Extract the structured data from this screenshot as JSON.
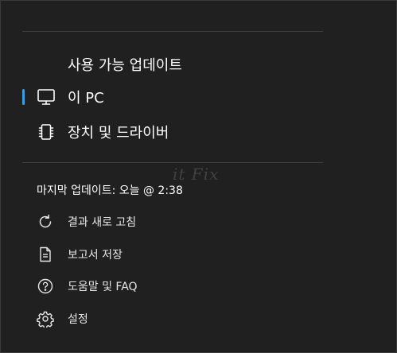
{
  "nav": {
    "items": [
      {
        "label": "사용 가능 업데이트",
        "icon": "",
        "selected": false
      },
      {
        "label": "이 PC",
        "icon": "monitor-icon",
        "selected": true
      },
      {
        "label": "장치 및 드라이버",
        "icon": "chip-icon",
        "selected": false
      }
    ]
  },
  "status": {
    "last_update": "마지막 업데이트: 오늘 @ 2:38"
  },
  "actions": [
    {
      "label": "결과 새로 고침",
      "icon": "refresh-icon"
    },
    {
      "label": "보고서 저장",
      "icon": "document-icon"
    },
    {
      "label": "도움말 및 FAQ",
      "icon": "help-icon"
    },
    {
      "label": "설정",
      "icon": "gear-icon"
    }
  ],
  "watermark": "it Fix",
  "colors": {
    "background": "#202020",
    "accent": "#3c9ee0",
    "divider": "#3d3d3d",
    "text": "#ffffff"
  }
}
